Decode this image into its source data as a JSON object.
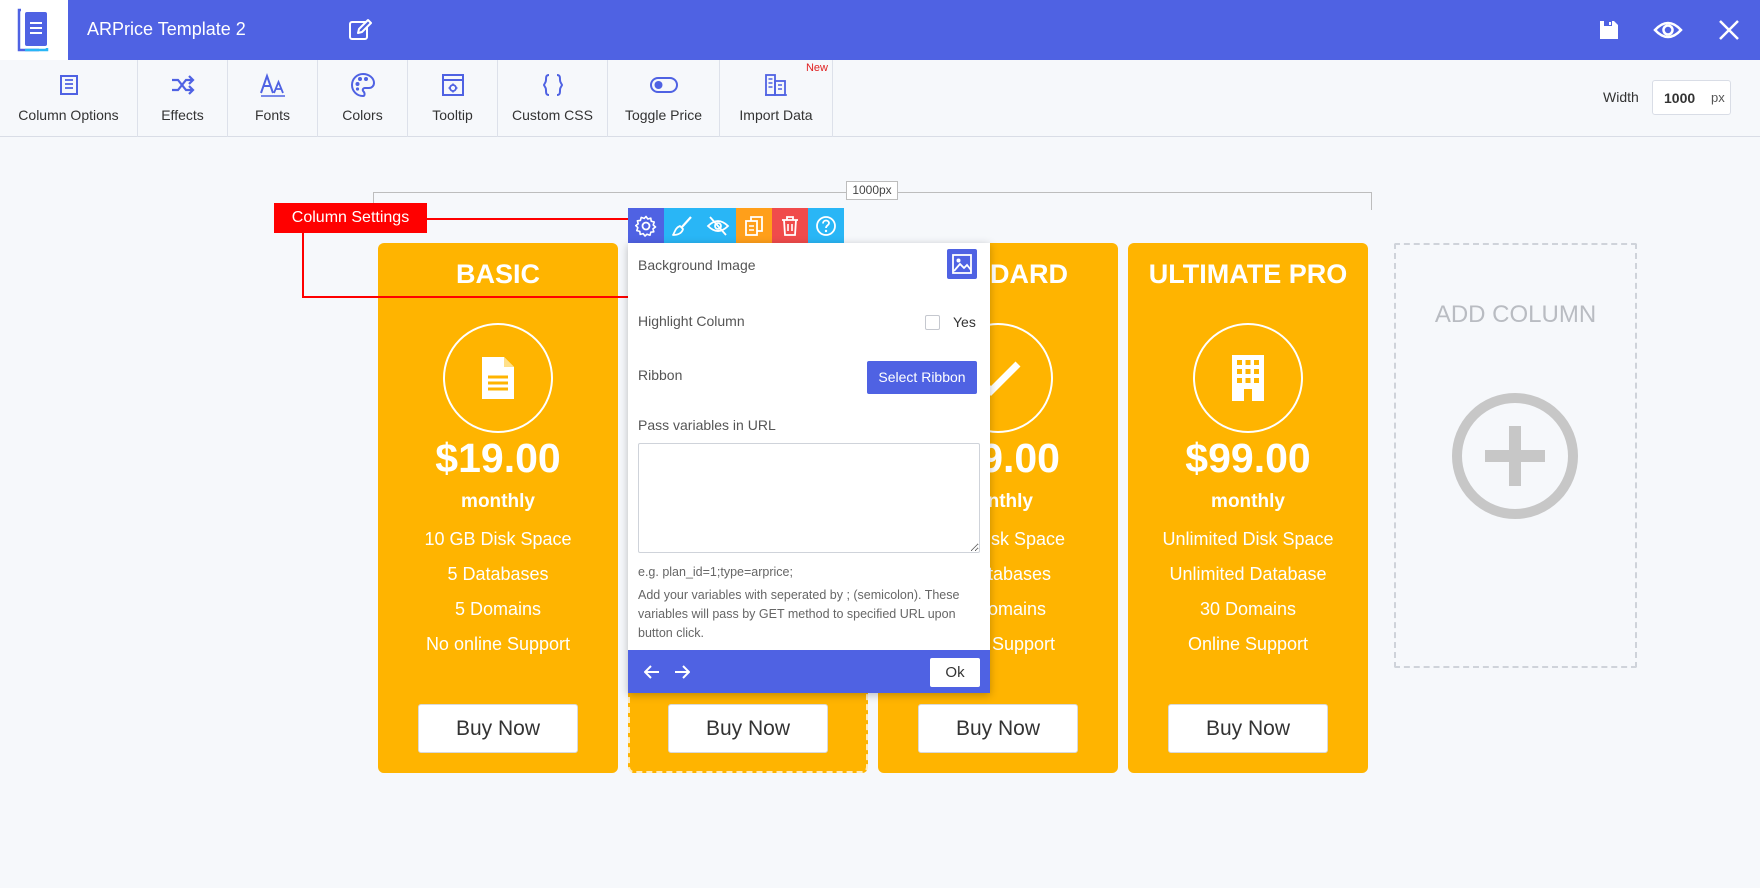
{
  "app": {
    "title": "ARPrice Template 2"
  },
  "toolbar": {
    "items": [
      {
        "label": "Column Options",
        "icon": "column-options-icon"
      },
      {
        "label": "Effects",
        "icon": "shuffle-icon"
      },
      {
        "label": "Fonts",
        "icon": "font-icon"
      },
      {
        "label": "Colors",
        "icon": "palette-icon"
      },
      {
        "label": "Tooltip",
        "icon": "tooltip-icon"
      },
      {
        "label": "Custom CSS",
        "icon": "braces-icon"
      },
      {
        "label": "Toggle Price",
        "icon": "toggle-icon"
      },
      {
        "label": "Import Data",
        "icon": "import-icon",
        "badge": "New"
      }
    ],
    "width_label": "Width",
    "width_value": "1000",
    "width_unit": "px"
  },
  "ruler": {
    "label": "1000px"
  },
  "callout": {
    "label": "Column Settings"
  },
  "columns": [
    {
      "title": "BASIC",
      "icon": "document-icon",
      "price": "$19.00",
      "period": "monthly",
      "features": [
        "10 GB Disk Space",
        "5 Databases",
        "5 Domains",
        "No online Support"
      ],
      "button": "Buy Now"
    },
    {
      "title": "",
      "icon": "",
      "price": "",
      "period": "",
      "features": [],
      "button": "Buy Now"
    },
    {
      "title": "DARD",
      "icon": "check-icon",
      "price": "9.00",
      "period": "nthly",
      "features": [
        "Disk Space",
        "tabases",
        "omains",
        "Support"
      ],
      "button": "Buy Now"
    },
    {
      "title": "ULTIMATE PRO",
      "icon": "building-icon",
      "price": "$99.00",
      "period": "monthly",
      "features": [
        "Unlimited Disk Space",
        "Unlimited Database",
        "30 Domains",
        "Online Support"
      ],
      "button": "Buy Now"
    }
  ],
  "add_column": {
    "label": "ADD COLUMN"
  },
  "popup": {
    "background_image_label": "Background Image",
    "highlight_label": "Highlight Column",
    "highlight_option": "Yes",
    "ribbon_label": "Ribbon",
    "ribbon_button": "Select Ribbon",
    "url_label": "Pass variables in URL",
    "url_value": "",
    "example": "e.g. plan_id=1;type=arprice;",
    "help": "Add your variables with seperated by ; (semicolon). These variables will pass by GET method to specified URL upon button click.",
    "ok_button": "Ok"
  },
  "colors": {
    "accent": "#4f62e3",
    "column": "#ffb400",
    "callout": "#ff0000"
  }
}
